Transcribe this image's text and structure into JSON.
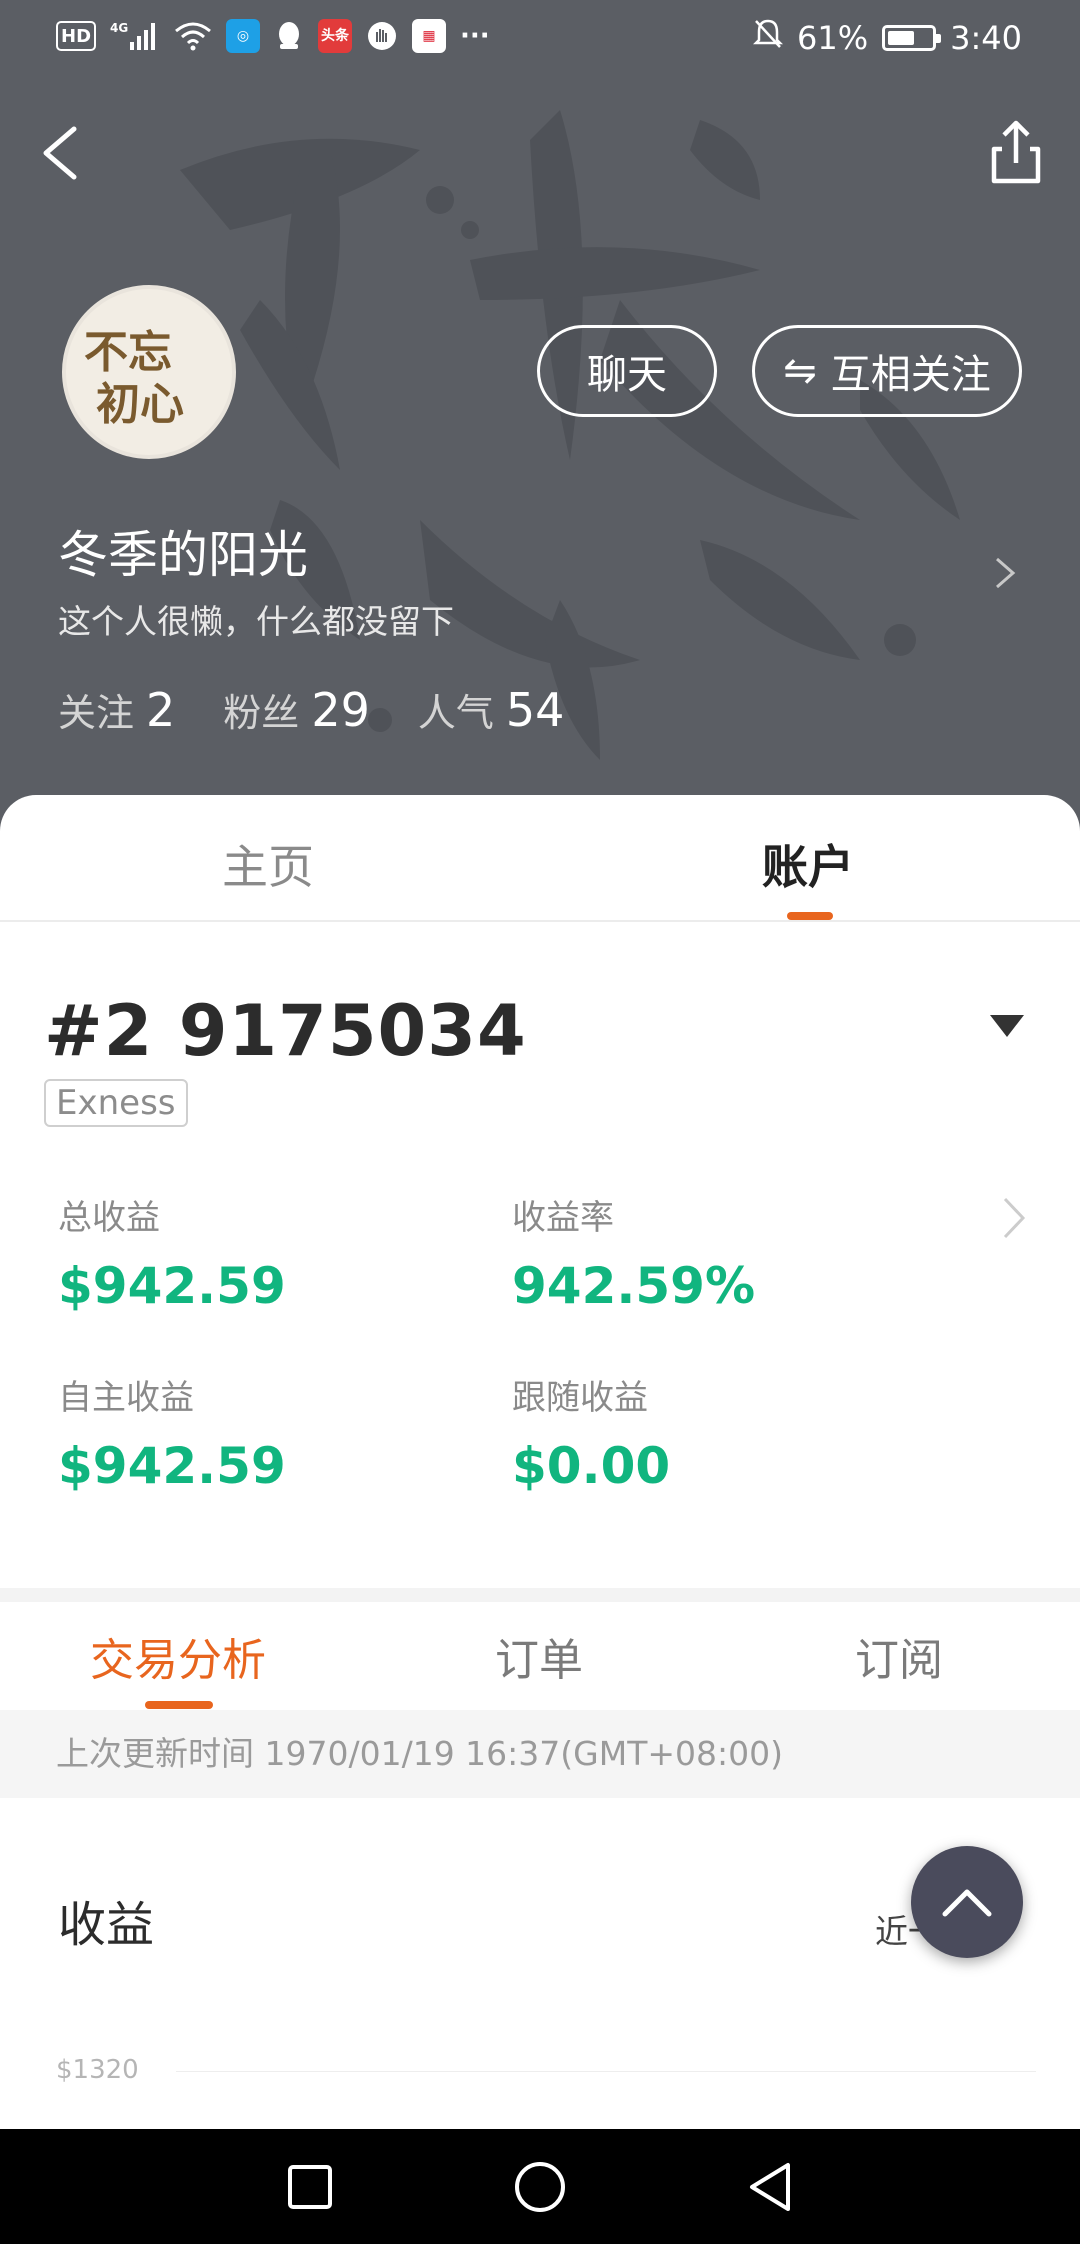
{
  "status_bar": {
    "network": "4G",
    "hd": "HD",
    "apps": [
      "头条"
    ],
    "more": "···",
    "battery_percent": "61%",
    "battery_level": 0.61,
    "time": "3:40"
  },
  "profile": {
    "name": "冬季的阳光",
    "bio": "这个人很懒，什么都没留下",
    "chat_label": "聊天",
    "follow_label": "互相关注",
    "follow_icon": "⇋",
    "avatar_text": [
      "不忘",
      "初心"
    ],
    "stats": [
      {
        "label": "关注",
        "value": "2"
      },
      {
        "label": "粉丝",
        "value": "29"
      },
      {
        "label": "人气",
        "value": "54"
      }
    ]
  },
  "main_tabs": [
    {
      "label": "主页",
      "active": false
    },
    {
      "label": "账户",
      "active": true
    }
  ],
  "account": {
    "number": "#2 9175034",
    "broker": "Exness",
    "metrics": [
      {
        "label": "总收益",
        "value": "$942.59"
      },
      {
        "label": "收益率",
        "value": "942.59%"
      },
      {
        "label": "自主收益",
        "value": "$942.59"
      },
      {
        "label": "跟随收益",
        "value": "$0.00"
      }
    ]
  },
  "sub_tabs": [
    {
      "label": "交易分析",
      "active": true
    },
    {
      "label": "订单",
      "active": false
    },
    {
      "label": "订阅",
      "active": false
    }
  ],
  "update_text": "上次更新时间 1970/01/19 16:37(GMT+08:00)",
  "earnings": {
    "title": "收益",
    "range": "近一年",
    "y_tick": "$1320"
  },
  "colors": {
    "accent": "#e8651e",
    "positive": "#11b57f",
    "header_bg": "#5b5e64"
  }
}
